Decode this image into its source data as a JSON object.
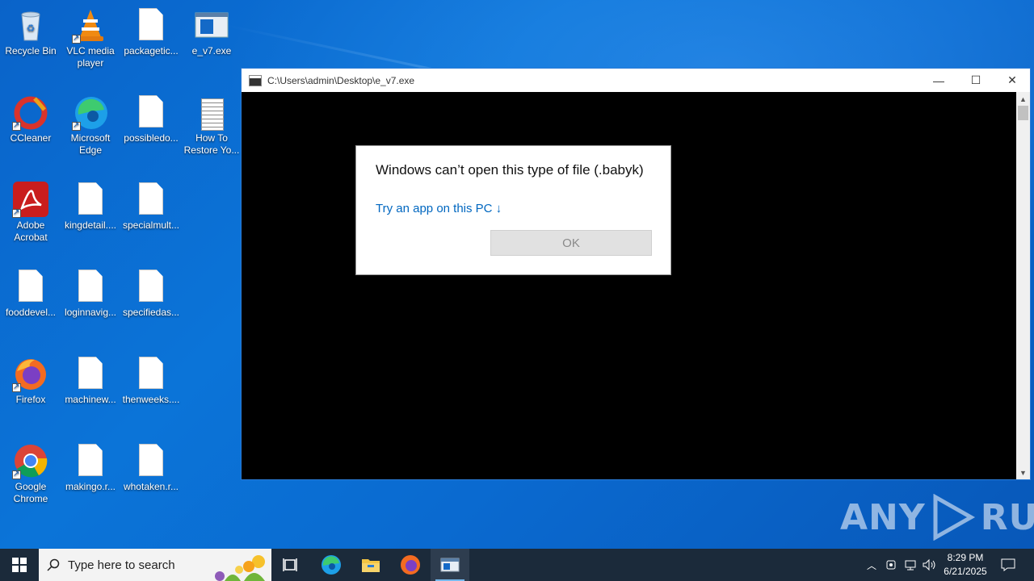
{
  "desktop": {
    "icons": [
      {
        "label": "Recycle Bin",
        "icon": "recycle-bin-icon"
      },
      {
        "label": "VLC media player",
        "icon": "vlc-icon"
      },
      {
        "label": "packagetic...",
        "icon": "file-icon"
      },
      {
        "label": "e_v7.exe",
        "icon": "exe-icon"
      },
      {
        "label": "CCleaner",
        "icon": "ccleaner-icon"
      },
      {
        "label": "Microsoft Edge",
        "icon": "edge-icon"
      },
      {
        "label": "possibledo...",
        "icon": "file-icon"
      },
      {
        "label": "How To Restore Yo...",
        "icon": "text-file-icon"
      },
      {
        "label": "Adobe Acrobat",
        "icon": "acrobat-icon"
      },
      {
        "label": "kingdetail....",
        "icon": "file-icon"
      },
      {
        "label": "specialmult...",
        "icon": "file-icon"
      },
      {
        "label": "fooddevel...",
        "icon": "file-icon"
      },
      {
        "label": "loginnavig...",
        "icon": "file-icon"
      },
      {
        "label": "specifiedas...",
        "icon": "file-icon"
      },
      {
        "label": "Firefox",
        "icon": "firefox-icon"
      },
      {
        "label": "machinew...",
        "icon": "file-icon"
      },
      {
        "label": "thenweeks....",
        "icon": "file-icon"
      },
      {
        "label": "Google Chrome",
        "icon": "chrome-icon"
      },
      {
        "label": "makingo.r...",
        "icon": "file-icon"
      },
      {
        "label": "whotaken.r...",
        "icon": "file-icon"
      }
    ]
  },
  "window": {
    "title": "C:\\Users\\admin\\Desktop\\e_v7.exe",
    "minimize": "—",
    "maximize": "☐",
    "close": "✕"
  },
  "dialog": {
    "title": "Windows can’t open this type of file (.babyk)",
    "link": "Try an app on this PC ↓",
    "ok": "OK"
  },
  "watermark": {
    "left": "ANY",
    "right": "RUN"
  },
  "taskbar": {
    "search_placeholder": "Type here to search",
    "time": "8:29 PM",
    "date": "6/21/2025"
  },
  "colors": {
    "desktop": "#0b74d8",
    "taskbar": "#1b2a3a",
    "link": "#0067c0"
  }
}
